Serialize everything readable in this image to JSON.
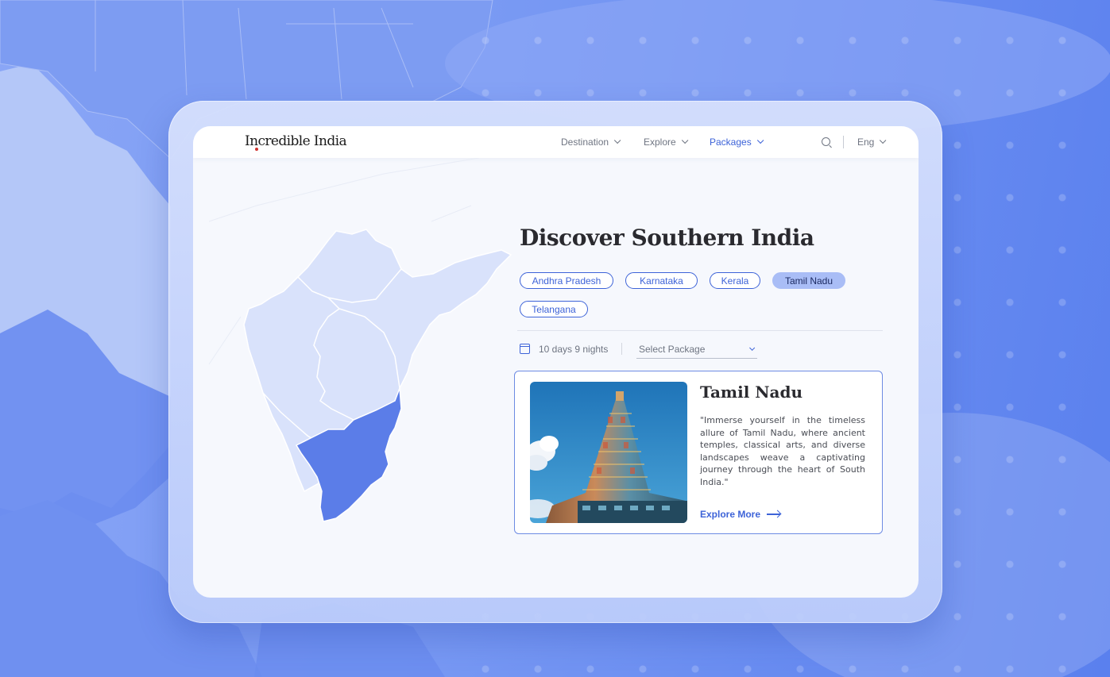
{
  "brand": {
    "logo_text": "Incredible India"
  },
  "nav": {
    "items": [
      {
        "label": "Destination",
        "active": false
      },
      {
        "label": "Explore",
        "active": false
      },
      {
        "label": "Packages",
        "active": true
      }
    ],
    "language": "Eng",
    "icons": {
      "search": "search-icon",
      "language_chevron": "chevron-down-icon"
    }
  },
  "hero": {
    "title": "Discover Southern India"
  },
  "states": {
    "options": [
      "Andhra Pradesh",
      "Karnataka",
      "Kerala",
      "Tamil Nadu",
      "Telangana"
    ],
    "selected": "Tamil Nadu"
  },
  "filters": {
    "duration": "10 days 9 nights",
    "package_placeholder": "Select Package",
    "icons": {
      "duration": "calendar-icon",
      "package": "chevron-down-icon"
    }
  },
  "card": {
    "title": "Tamil Nadu",
    "description": "\"Immerse yourself in the timeless allure of Tamil Nadu, where ancient temples, classical arts, and diverse landscapes weave a captivating journey through the heart of South India.\"",
    "cta": "Explore More",
    "image": "temple-gopuram-photo"
  },
  "colors": {
    "accent": "#3d63d8",
    "selected_chip": "#a9bdf6",
    "map_region": "#d9e2fb",
    "map_highlight": "#5b7de8",
    "background": "#6b8ef0"
  }
}
